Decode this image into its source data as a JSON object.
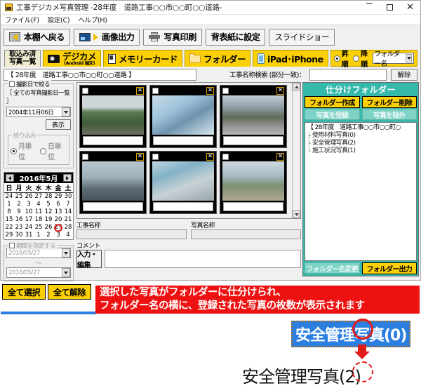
{
  "window": {
    "title": "工事デジカメ写真管理 -28年度　道路工事○○市○○町○○道路-",
    "minimize": "—",
    "maximize": "□",
    "close": "✕"
  },
  "menu": [
    {
      "label": "ファイル(F)"
    },
    {
      "label": "設定(C)"
    },
    {
      "label": "ヘルプ(H)"
    }
  ],
  "toolbar": [
    {
      "label": "本棚へ戻る",
      "icon": "shelf-back-icon"
    },
    {
      "label": "画像出力",
      "icon": "image-export-icon"
    },
    {
      "label": "写真印刷",
      "icon": "printer-icon"
    },
    {
      "label": "背表紙に設定",
      "icon": "none"
    },
    {
      "label": "スライドショー",
      "icon": "none"
    }
  ],
  "tabs": [
    {
      "label": "取込み済",
      "label2": "写真一覧",
      "sub": "",
      "icon": "none",
      "active": true
    },
    {
      "label": "デジカメ",
      "label2": "",
      "sub": "(Android 端末)",
      "icon": "camera-icon",
      "active": false
    },
    {
      "label": "メモリーカード",
      "label2": "",
      "sub": "",
      "icon": "memory-card-icon",
      "active": false
    },
    {
      "label": "フォルダー",
      "label2": "",
      "sub": "",
      "icon": "folder-icon",
      "active": false
    },
    {
      "label": "iPad･iPhone",
      "label2": "",
      "sub": "",
      "icon": "phone-icon",
      "active": false
    }
  ],
  "sort": {
    "ascending_label": "昇順",
    "descending_label": "降順",
    "ascending_selected": true,
    "key": "フォルダー名"
  },
  "search": {
    "project": "【 28年度　道路工事○○市○○町○○道路 】",
    "label": "工事名称検索 (部分一致)：",
    "value": "",
    "placeholder": "",
    "clear_label": "解除"
  },
  "left_panel": {
    "filter_group_label": "撮影日で絞る",
    "all_dates_label": "［ 全ての写真撮影日一覧 ］",
    "date_value": "2004年11月06日",
    "display_button": "表示",
    "narrow_group_label": "絞り込み",
    "month_unit": "月単位",
    "day_unit": "日単位",
    "calendar": {
      "prev": "◀",
      "next": "▶",
      "month_label": "2016年5月",
      "dow": [
        "日",
        "月",
        "火",
        "水",
        "木",
        "金",
        "土"
      ],
      "weeks": [
        [
          "24",
          "25",
          "26",
          "27",
          "28",
          "29",
          "30"
        ],
        [
          "1",
          "2",
          "3",
          "4",
          "5",
          "6",
          "7"
        ],
        [
          "8",
          "9",
          "10",
          "11",
          "12",
          "13",
          "14"
        ],
        [
          "15",
          "16",
          "17",
          "18",
          "19",
          "20",
          "21"
        ],
        [
          "22",
          "23",
          "24",
          "25",
          "26",
          "27",
          "28"
        ],
        [
          "29",
          "30",
          "31",
          "1",
          "2",
          "3",
          "4"
        ]
      ],
      "today": "27"
    },
    "range_group_label": "期間を指定する",
    "range_from": "2016/05/27",
    "range_sep": "～",
    "range_to": "2016/05/27"
  },
  "photos": [
    {
      "name": "",
      "caption": ""
    },
    {
      "name": "",
      "caption": ""
    },
    {
      "name": "",
      "caption": ""
    },
    {
      "name": "",
      "caption": ""
    },
    {
      "name": "",
      "caption": ""
    },
    {
      "name": "",
      "caption": ""
    }
  ],
  "fields": {
    "work_name_label": "工事名称",
    "work_name_value": "",
    "photo_name_label": "写真名称",
    "photo_name_value": "",
    "comment_label": "コメント",
    "comment_button": "入力・編集",
    "comment_value": ""
  },
  "right_panel": {
    "title": "仕分けフォルダー",
    "create_label": "フォルダー作成",
    "delete_label": "フォルダー削除",
    "register_label": "写真を登録",
    "exclude_label": "写真を除外",
    "tree": {
      "root": "【 28年度　道路工事○○市○○町○",
      "children": [
        "使用材料写真(0)",
        "安全管理写真(2)",
        "施工状況写真(1)"
      ]
    },
    "rename_label": "フォルダー名変更",
    "output_label": "フォルダー出力"
  },
  "selection": {
    "select_all": "全て選択",
    "clear_all": "全て解除"
  },
  "banner": {
    "line1": "選択した写真がフォルダーに仕分けられ、",
    "line2": "フォルダー名の横に、登録された写真の枚数が表示されます"
  },
  "callout": {
    "before": "安全管理写真(0)",
    "after": "安全管理写真(2)"
  },
  "colors": {
    "accent_yellow": "#fcd006",
    "panel_teal": "#35b9ab",
    "banner_red": "#ee1111",
    "highlight_blue": "#2b7fe0"
  }
}
